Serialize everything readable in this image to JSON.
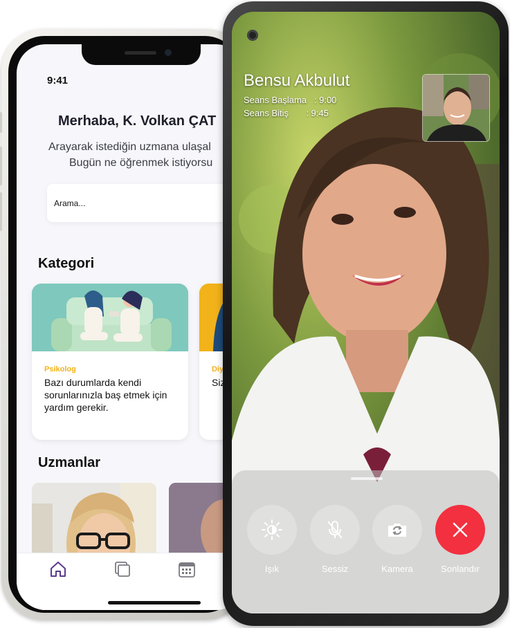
{
  "left_phone": {
    "status_time": "9:41",
    "greeting": "Merhaba, K. Volkan ÇAT",
    "subtitle_line1": "Arayarak istediğin uzmana ulaşal",
    "subtitle_line2": "Bugün ne öğrenmek istiyorsu",
    "search": {
      "placeholder": "Arama..."
    },
    "category_heading": "Kategori",
    "categories": [
      {
        "label": "Psikolog",
        "description": "Bazı durumlarda kendi sorunlarınızla baş etmek için yardım gerekir."
      },
      {
        "label": "Diy",
        "description": "Siz fa ya"
      }
    ],
    "experts_heading": "Uzmanlar",
    "tabs": [
      {
        "icon": "home-icon"
      },
      {
        "icon": "pages-icon"
      },
      {
        "icon": "calendar-icon"
      }
    ],
    "colors": {
      "accent": "#5b3a8e",
      "category_label": "#f2b21a",
      "card_bg": "#7fc8bd"
    }
  },
  "call_screen": {
    "caller_name": "Bensu Akbulut",
    "session_start": "Seans Başlama   : 9:00",
    "session_end": "Seans Bitiş       : 9:45",
    "controls": [
      {
        "label": "Işık",
        "icon": "brightness-icon"
      },
      {
        "label": "Sessiz",
        "icon": "mic-off-icon"
      },
      {
        "label": "Kamera",
        "icon": "camera-switch-icon"
      },
      {
        "label": "Sonlandır",
        "icon": "close-icon"
      }
    ],
    "colors": {
      "end_call": "#f2303f"
    }
  }
}
